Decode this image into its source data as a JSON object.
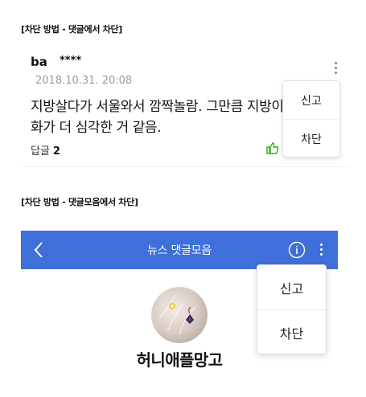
{
  "captions": {
    "section1": "[차단 방법 - 댓글에서 차단]",
    "section2": "[차단 방법 - 댓글모음에서 차단]"
  },
  "comment": {
    "author": "ba",
    "author_mask": "****",
    "timestamp": "2018.10.31. 20:08",
    "text": "지방살다가 서울와서 깜짝놀람. 그만큼 지방이\n화가 더 심각한 거 같음.",
    "reply_label": "답글",
    "reply_count": "2"
  },
  "comment_menu": {
    "report": "신고",
    "block": "차단"
  },
  "app_bar": {
    "title": "뉴스 댓글모음"
  },
  "profile": {
    "name": "허니애플망고"
  },
  "profile_menu": {
    "report": "신고",
    "block": "차단"
  },
  "colors": {
    "app_bar": "#3f6fd8",
    "like_green": "#2db400",
    "timestamp_gray": "#9a9a9a"
  },
  "icons": [
    "more-vertical-icon",
    "thumbs-up-icon",
    "back-chevron-icon",
    "info-icon"
  ]
}
